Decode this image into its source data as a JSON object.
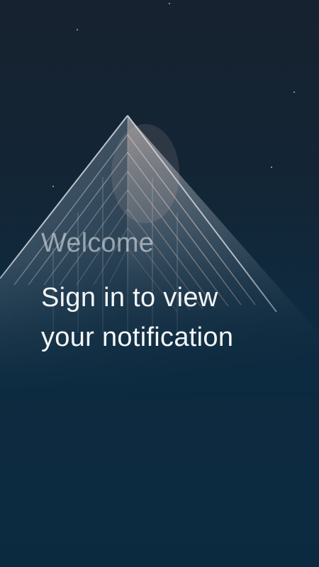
{
  "screen": {
    "welcome_text": "Welcome",
    "subtitle_line_1": "Sign in to view",
    "subtitle_line_2": "your notification"
  },
  "background": {
    "image": "glass-pyramid-building-at-night",
    "colors": {
      "top": "#16222f",
      "bottom": "#0b2a40",
      "accent_glow": "#e7c3b4"
    }
  }
}
